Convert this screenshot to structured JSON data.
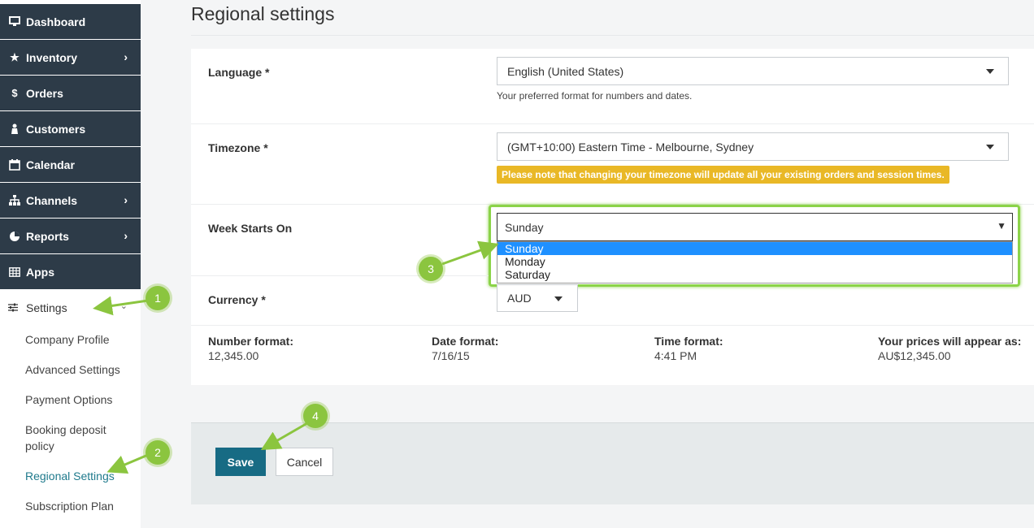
{
  "sidebar": {
    "items": [
      {
        "label": "Dashboard",
        "icon": "monitor-icon"
      },
      {
        "label": "Inventory",
        "icon": "star-icon"
      },
      {
        "label": "Orders",
        "icon": "dollar-icon"
      },
      {
        "label": "Customers",
        "icon": "person-icon"
      },
      {
        "label": "Calendar",
        "icon": "calendar-icon"
      },
      {
        "label": "Channels",
        "icon": "sitemap-icon"
      },
      {
        "label": "Reports",
        "icon": "pie-chart-icon"
      },
      {
        "label": "Apps",
        "icon": "grid-icon"
      }
    ],
    "settings": {
      "label": "Settings",
      "icon": "sliders-icon"
    },
    "sub_items": [
      "Company Profile",
      "Advanced Settings",
      "Payment Options",
      "Booking deposit policy",
      "Regional Settings",
      "Subscription Plan"
    ]
  },
  "page": {
    "title": "Regional settings"
  },
  "form": {
    "language": {
      "label": "Language *",
      "value": "English (United States)",
      "help": "Your preferred format for numbers and dates."
    },
    "timezone": {
      "label": "Timezone *",
      "value": "(GMT+10:00) Eastern Time - Melbourne, Sydney",
      "warning": "Please note that changing your timezone will update all your existing orders and session times."
    },
    "week_start": {
      "label": "Week Starts On",
      "value": "Sunday",
      "options": [
        "Sunday",
        "Monday",
        "Saturday"
      ]
    },
    "currency": {
      "label": "Currency *",
      "value": "AUD"
    }
  },
  "formats": {
    "number": {
      "label": "Number format:",
      "value": "12,345.00"
    },
    "date": {
      "label": "Date format:",
      "value": "7/16/15"
    },
    "time": {
      "label": "Time format:",
      "value": "4:41 PM"
    },
    "price": {
      "label": "Your prices will appear as:",
      "value": "AU$12,345.00"
    }
  },
  "actions": {
    "save": "Save",
    "cancel": "Cancel"
  },
  "callouts": [
    "1",
    "2",
    "3",
    "4"
  ],
  "colors": {
    "sidebar_bg": "#2d3b48",
    "accent": "#176b84",
    "callout": "#8bc53f",
    "warning": "#e9b826"
  }
}
